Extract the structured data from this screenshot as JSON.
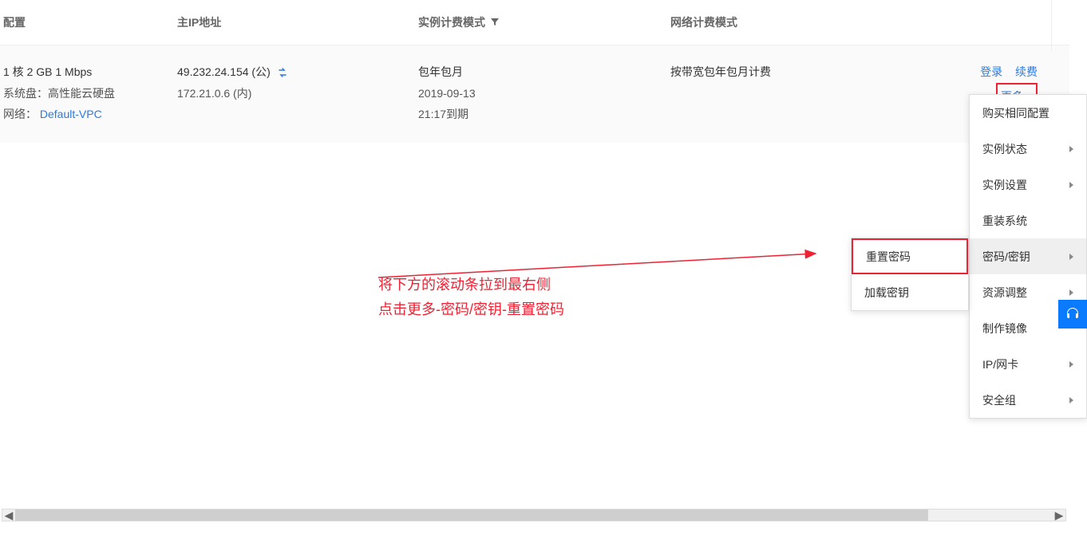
{
  "table": {
    "headers": {
      "config": "配置",
      "ip": "主IP地址",
      "billing": "实例计费模式",
      "network_billing": "网络计费模式"
    },
    "row": {
      "config_spec": "1 核 2 GB 1 Mbps",
      "config_disk_label": "系统盘：",
      "config_disk_value": "高性能云硬盘",
      "config_net_label": "网络：",
      "config_net_value": "Default-VPC",
      "ip_public": "49.232.24.154 (公)",
      "ip_private": "172.21.0.6 (内)",
      "billing_type": "包年包月",
      "billing_date": "2019-09-13",
      "billing_expire": "21:17到期",
      "net_billing_value": "按带宽包年包月计费"
    },
    "actions": {
      "login": "登录",
      "renew": "续费",
      "more": "更多"
    }
  },
  "dropdown": {
    "items": [
      {
        "label": "购买相同配置",
        "has_sub": false
      },
      {
        "label": "实例状态",
        "has_sub": true
      },
      {
        "label": "实例设置",
        "has_sub": true
      },
      {
        "label": "重装系统",
        "has_sub": false
      },
      {
        "label": "密码/密钥",
        "has_sub": true,
        "active": true
      },
      {
        "label": "资源调整",
        "has_sub": true
      },
      {
        "label": "制作镜像",
        "has_sub": false
      },
      {
        "label": "IP/网卡",
        "has_sub": true
      },
      {
        "label": "安全组",
        "has_sub": true
      }
    ]
  },
  "submenu": {
    "items": [
      {
        "label": "重置密码",
        "boxed": true
      },
      {
        "label": "加载密钥",
        "boxed": false
      }
    ]
  },
  "annotation": {
    "line1": "将下方的滚动条拉到最右侧",
    "line2": "点击更多-密码/密钥-重置密码"
  },
  "colors": {
    "link": "#2a7ae2",
    "highlight": "#e23",
    "fab": "#0a7aff"
  }
}
